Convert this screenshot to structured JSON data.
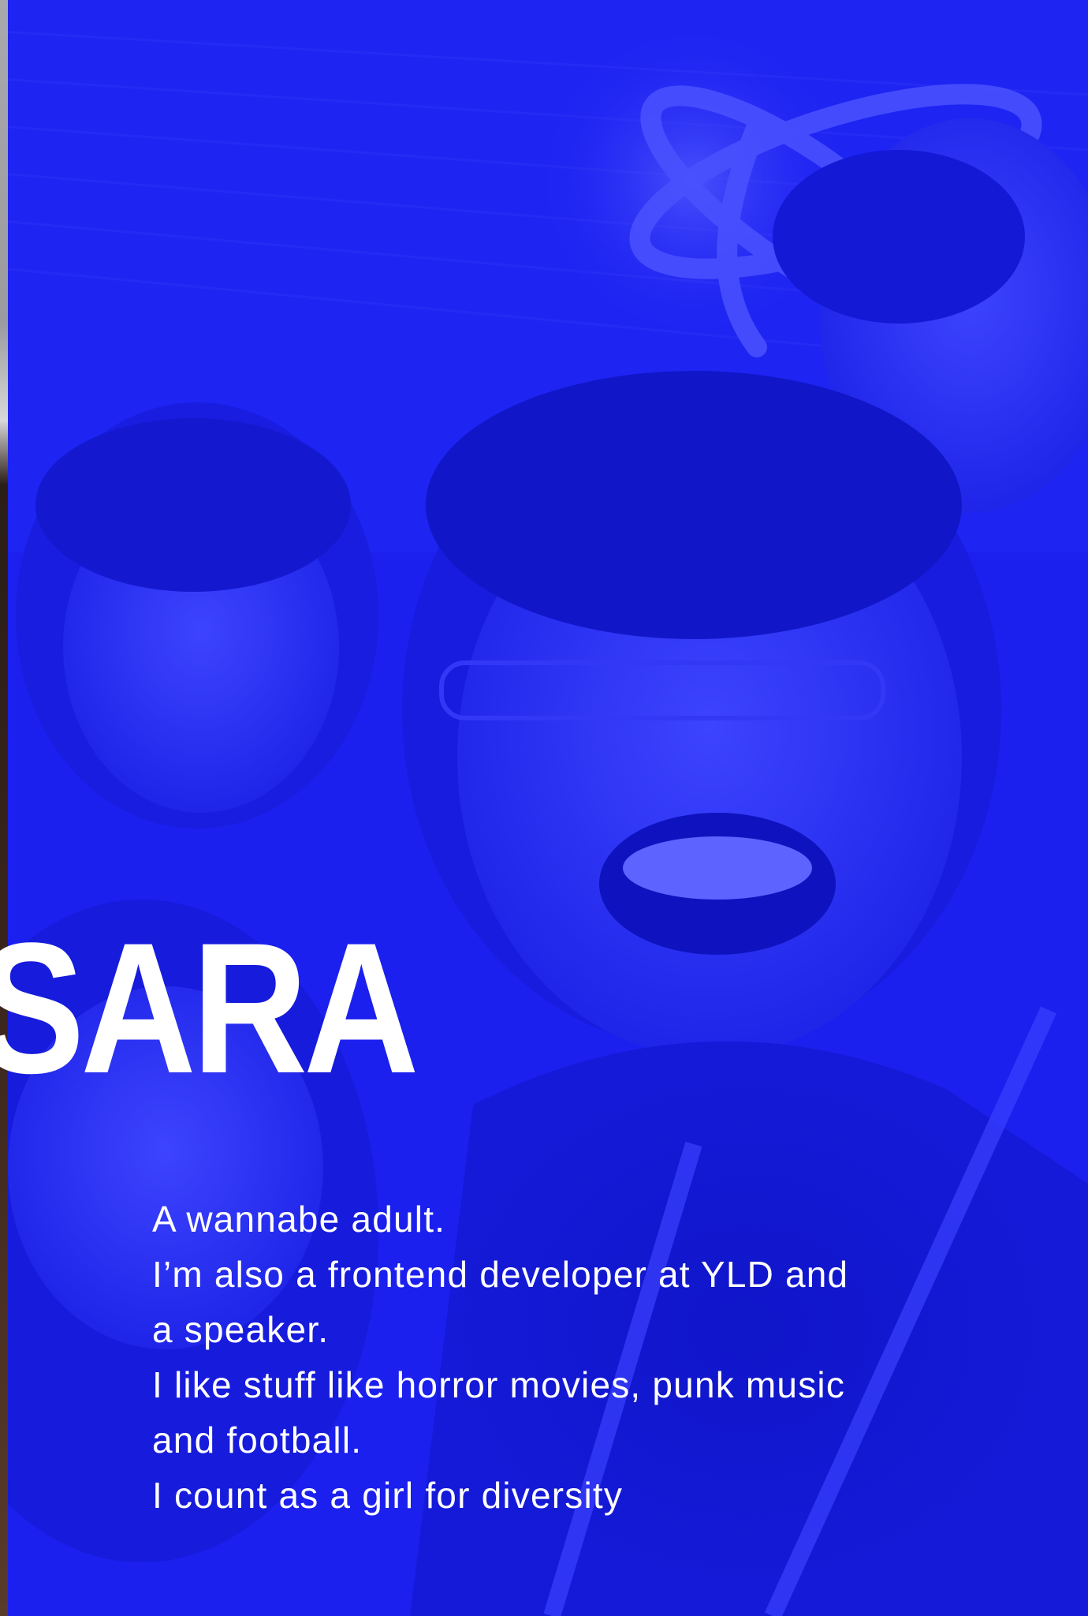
{
  "name": "SARA",
  "bio": {
    "lines": [
      "A wannabe adult.",
      "I’m also a frontend developer at YLD and",
      "a speaker.",
      "I like stuff like horror movies, punk music",
      "and football.",
      "I count as a girl for diversity"
    ]
  },
  "colors": {
    "background": "#1a1ff0",
    "text": "#ffffff"
  }
}
